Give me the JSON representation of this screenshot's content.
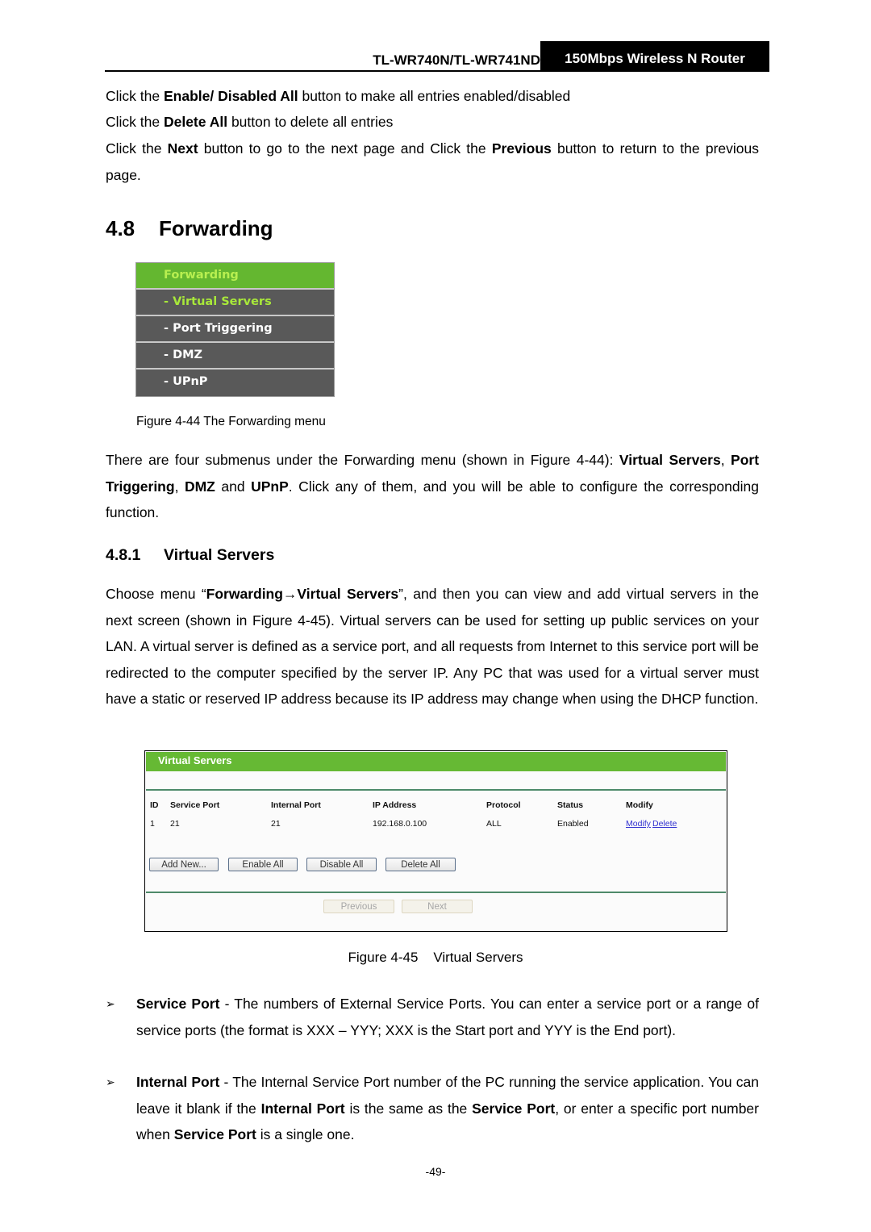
{
  "header": {
    "model": "TL-WR740N/TL-WR741ND",
    "product": "150Mbps Wireless N Router"
  },
  "intro": {
    "line1": {
      "pre": "Click the ",
      "bold": "Enable/ Disabled All",
      "post": " button to make all entries enabled/disabled"
    },
    "line2": {
      "pre": "Click the ",
      "bold": "Delete All",
      "post": " button to delete all entries"
    },
    "line3": {
      "pre": "Click the ",
      "bold1": "Next",
      "mid": " button to go to the next page and Click the ",
      "bold2": "Previous",
      "post": " button to return to the previous page."
    }
  },
  "section": {
    "number": "4.8",
    "title": "Forwarding"
  },
  "forwarding_menu": {
    "header": "Forwarding",
    "items": [
      {
        "label": "- Virtual Servers",
        "active": true
      },
      {
        "label": "- Port Triggering",
        "active": false
      },
      {
        "label": "- DMZ",
        "active": false
      },
      {
        "label": "- UPnP",
        "active": false
      }
    ],
    "caption": "Figure 4-44 The Forwarding menu"
  },
  "submenus_paragraph": {
    "p1": "There are four submenus under the Forwarding menu (shown in Figure 4-44): ",
    "b1": "Virtual Servers",
    "p2": ", ",
    "b2": "Port Triggering",
    "p3": ", ",
    "b3": "DMZ",
    "p4": " and ",
    "b4": "UPnP",
    "p5": ". Click any of them, and you will be able to configure the corresponding function."
  },
  "subsection": {
    "number": "4.8.1",
    "title": "Virtual Servers"
  },
  "vs_paragraph": {
    "p1": "Choose menu “",
    "b1": "Forwarding→Virtual Servers",
    "p2": "”, and then you can view and add virtual servers in the next screen (shown in Figure 4-45). Virtual servers can be used for setting up public services on your LAN. A virtual server is defined as a service port, and all requests from Internet to this service port will be redirected to the computer specified by the server IP. Any PC that was used for a virtual server must have a static or reserved IP address because its IP address may change when using the DHCP function."
  },
  "virtual_servers_panel": {
    "title": "Virtual Servers",
    "columns": [
      "ID",
      "Service Port",
      "Internal Port",
      "IP Address",
      "Protocol",
      "Status",
      "Modify"
    ],
    "rows": [
      {
        "id": "1",
        "service_port": "21",
        "internal_port": "21",
        "ip_address": "192.168.0.100",
        "protocol": "ALL",
        "status": "Enabled",
        "modify": "Modify",
        "delete": "Delete"
      }
    ],
    "buttons": {
      "add_new": "Add New...",
      "enable_all": "Enable All",
      "disable_all": "Disable All",
      "delete_all": "Delete All",
      "previous": "Previous",
      "next": "Next"
    },
    "caption": "Figure 4-45    Virtual Servers"
  },
  "bullets": [
    {
      "bold": "Service Port",
      "text": " - The numbers of External Service Ports. You can enter a service port or a range of service ports (the format is XXX – YYY; XXX is the Start port and YYY is the End port)."
    },
    {
      "bold": "Internal Port",
      "t1": " - The Internal Service Port number of the PC running the service application. You can leave it blank if the ",
      "b2": "Internal Port",
      "t2": " is the same as the ",
      "b3": "Service Port",
      "t3": ", or enter a specific port number when ",
      "b4": "Service Port",
      "t4": " is a single one."
    }
  ],
  "bullet_glyph": "➢",
  "page_number": "-49-"
}
